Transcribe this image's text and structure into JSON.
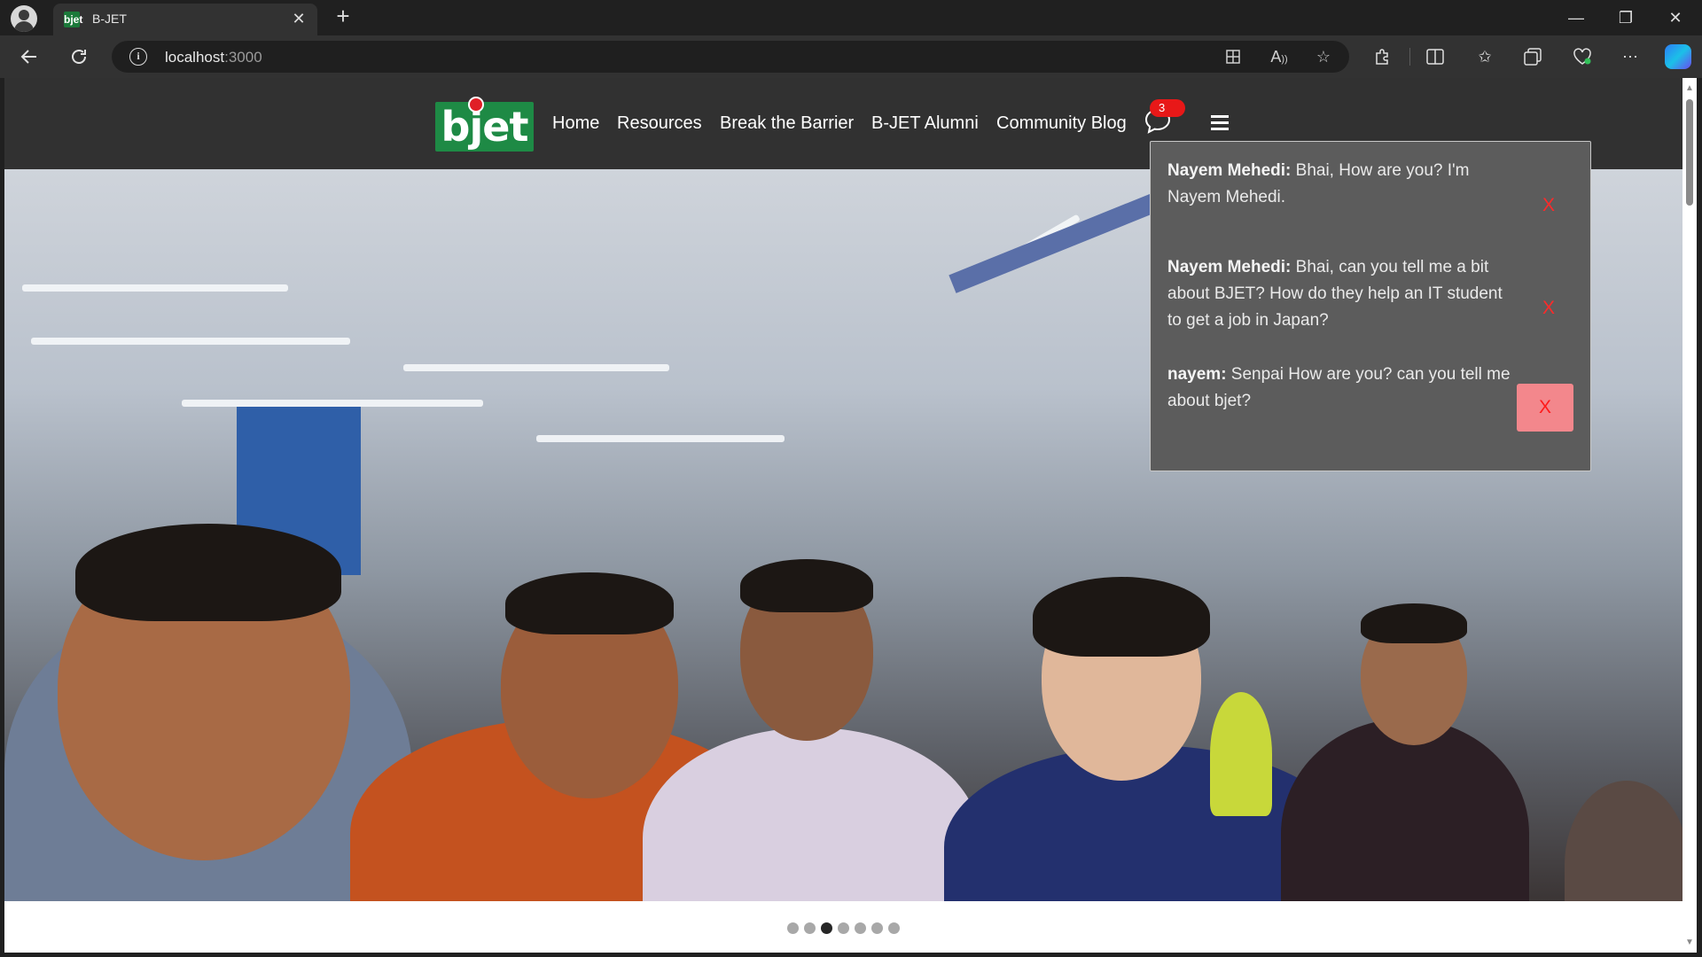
{
  "browser": {
    "tab": {
      "favicon_text": "bjet",
      "title": "B-JET",
      "close_glyph": "✕"
    },
    "new_tab_glyph": "+",
    "window_controls": {
      "minimize": "—",
      "restore": "❐",
      "close": "✕"
    },
    "address": {
      "host": "localhost",
      "port": ":3000"
    },
    "icons": [
      "back-icon",
      "reload-icon",
      "site-info-icon",
      "apps-icon",
      "read-aloud-icon",
      "favorite-star-icon",
      "extensions-icon",
      "split-screen-icon",
      "favorites-icon",
      "collections-icon",
      "browser-essentials-icon",
      "more-icon",
      "copilot-icon"
    ]
  },
  "navbar": {
    "logo_text": "bjet",
    "items": [
      {
        "label": "Home"
      },
      {
        "label": "Resources"
      },
      {
        "label": "Break the Barrier"
      },
      {
        "label": "B-JET Alumni"
      },
      {
        "label": "Community Blog"
      }
    ],
    "chat_badge_count": "3"
  },
  "chat_panel": {
    "messages": [
      {
        "sender": "Nayem Mehedi:",
        "text": " Bhai, How are you? I'm Nayem Mehedi.",
        "dismiss_label": "X"
      },
      {
        "sender": "Nayem Mehedi:",
        "text": " Bhai, can you tell me a bit about BJET? How do they help an IT student to get a job in Japan?",
        "dismiss_label": "X"
      },
      {
        "sender": "nayem:",
        "text": " Senpai How are you? can you tell me about bjet?",
        "dismiss_label": "X"
      }
    ]
  },
  "carousel": {
    "slide_count": 7,
    "active_index": 2
  },
  "colors": {
    "navbar_bg": "#313131",
    "logo_green": "#1e8a45",
    "badge_red": "#e81818",
    "panel_bg": "#5c5c5c",
    "dismiss_red": "#ff2a2a",
    "dismiss_hover_bg": "#f3878c"
  }
}
